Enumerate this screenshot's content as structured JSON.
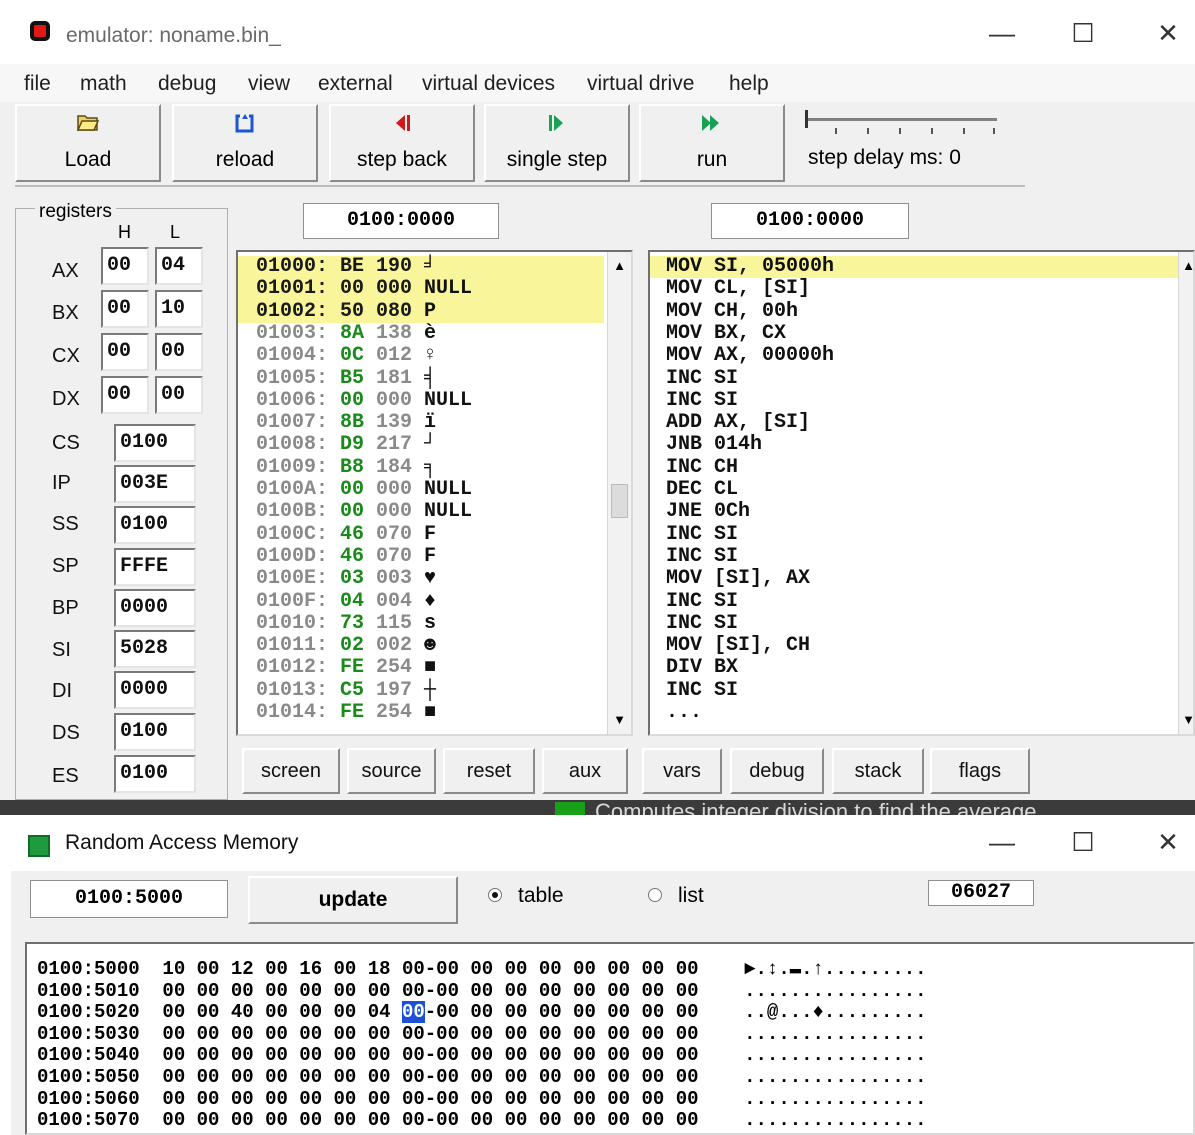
{
  "emulator_window": {
    "title": "emulator: noname.bin_",
    "controls": {
      "minimize": "—",
      "maximize": "☐",
      "close": "✕"
    },
    "menu": [
      "file",
      "math",
      "debug",
      "view",
      "external",
      "virtual devices",
      "virtual drive",
      "help"
    ],
    "toolbar": {
      "load": "Load",
      "reload": "reload",
      "step_back": "step back",
      "single_step": "single step",
      "run": "run",
      "step_delay": "step delay ms: 0"
    },
    "registers": {
      "legend": "registers",
      "col_h": "H",
      "col_l": "L",
      "gp": [
        {
          "name": "AX",
          "h": "00",
          "l": "04"
        },
        {
          "name": "BX",
          "h": "00",
          "l": "10"
        },
        {
          "name": "CX",
          "h": "00",
          "l": "00"
        },
        {
          "name": "DX",
          "h": "00",
          "l": "00"
        }
      ],
      "seg": [
        {
          "name": "CS",
          "value": "0100"
        },
        {
          "name": "IP",
          "value": "003E"
        },
        {
          "name": "SS",
          "value": "0100"
        },
        {
          "name": "SP",
          "value": "FFFE"
        },
        {
          "name": "BP",
          "value": "0000"
        },
        {
          "name": "SI",
          "value": "5028"
        },
        {
          "name": "DI",
          "value": "0000"
        },
        {
          "name": "DS",
          "value": "0100"
        },
        {
          "name": "ES",
          "value": "0100"
        }
      ]
    },
    "memory_address": "0100:0000",
    "disasm_address": "0100:0000",
    "memory_lines": [
      {
        "addr": "01000:",
        "hex": "BE",
        "dec": "190",
        "ch": "╛",
        "hl": true
      },
      {
        "addr": "01001:",
        "hex": "00",
        "dec": "000",
        "ch": "NULL",
        "hl": true
      },
      {
        "addr": "01002:",
        "hex": "50",
        "dec": "080",
        "ch": "P",
        "hl": true
      },
      {
        "addr": "01003:",
        "hex": "8A",
        "dec": "138",
        "ch": "è",
        "hl": false
      },
      {
        "addr": "01004:",
        "hex": "0C",
        "dec": "012",
        "ch": "♀",
        "hl": false
      },
      {
        "addr": "01005:",
        "hex": "B5",
        "dec": "181",
        "ch": "╡",
        "hl": false
      },
      {
        "addr": "01006:",
        "hex": "00",
        "dec": "000",
        "ch": "NULL",
        "hl": false
      },
      {
        "addr": "01007:",
        "hex": "8B",
        "dec": "139",
        "ch": "ï",
        "hl": false
      },
      {
        "addr": "01008:",
        "hex": "D9",
        "dec": "217",
        "ch": "┘",
        "hl": false
      },
      {
        "addr": "01009:",
        "hex": "B8",
        "dec": "184",
        "ch": "╕",
        "hl": false
      },
      {
        "addr": "0100A:",
        "hex": "00",
        "dec": "000",
        "ch": "NULL",
        "hl": false
      },
      {
        "addr": "0100B:",
        "hex": "00",
        "dec": "000",
        "ch": "NULL",
        "hl": false
      },
      {
        "addr": "0100C:",
        "hex": "46",
        "dec": "070",
        "ch": "F",
        "hl": false
      },
      {
        "addr": "0100D:",
        "hex": "46",
        "dec": "070",
        "ch": "F",
        "hl": false
      },
      {
        "addr": "0100E:",
        "hex": "03",
        "dec": "003",
        "ch": "♥",
        "hl": false
      },
      {
        "addr": "0100F:",
        "hex": "04",
        "dec": "004",
        "ch": "♦",
        "hl": false
      },
      {
        "addr": "01010:",
        "hex": "73",
        "dec": "115",
        "ch": "s",
        "hl": false
      },
      {
        "addr": "01011:",
        "hex": "02",
        "dec": "002",
        "ch": "☻",
        "hl": false
      },
      {
        "addr": "01012:",
        "hex": "FE",
        "dec": "254",
        "ch": "■",
        "hl": false
      },
      {
        "addr": "01013:",
        "hex": "C5",
        "dec": "197",
        "ch": "┼",
        "hl": false
      },
      {
        "addr": "01014:",
        "hex": "FE",
        "dec": "254",
        "ch": "■",
        "hl": false
      }
    ],
    "disasm_lines": [
      "MOV SI, 05000h",
      "MOV CL, [SI]",
      "MOV CH, 00h",
      "MOV BX, CX",
      "MOV AX, 00000h",
      "INC SI",
      "INC SI",
      "ADD AX, [SI]",
      "JNB 014h",
      "INC CH",
      "DEC CL",
      "JNE 0Ch",
      "INC SI",
      "INC SI",
      "MOV [SI], AX",
      "INC SI",
      "INC SI",
      "MOV [SI], CH",
      "DIV BX",
      "INC SI",
      "..."
    ],
    "bottom_buttons": [
      "screen",
      "source",
      "reset",
      "aux",
      "vars",
      "debug",
      "stack",
      "flags"
    ]
  },
  "background_window_text": "Computes integer division to find the average",
  "ram_window": {
    "title": "Random Access Memory",
    "controls": {
      "minimize": "—",
      "maximize": "☐",
      "close": "✕"
    },
    "address": "0100:5000",
    "update_label": "update",
    "radio_table": "table",
    "radio_list": "list",
    "value_box": "06027",
    "rows": [
      {
        "addr": "0100:5000",
        "bytes": [
          "10",
          "00",
          "12",
          "00",
          "16",
          "00",
          "18",
          "00",
          "00",
          "00",
          "00",
          "00",
          "00",
          "00",
          "00",
          "00"
        ],
        "ascii": "►.↕.▬.↑........."
      },
      {
        "addr": "0100:5010",
        "bytes": [
          "00",
          "00",
          "00",
          "00",
          "00",
          "00",
          "00",
          "00",
          "00",
          "00",
          "00",
          "00",
          "00",
          "00",
          "00",
          "00"
        ],
        "ascii": "................"
      },
      {
        "addr": "0100:5020",
        "bytes": [
          "00",
          "00",
          "40",
          "00",
          "00",
          "00",
          "04",
          "00",
          "00",
          "00",
          "00",
          "00",
          "00",
          "00",
          "00",
          "00"
        ],
        "ascii": "..@...♦........."
      },
      {
        "addr": "0100:5030",
        "bytes": [
          "00",
          "00",
          "00",
          "00",
          "00",
          "00",
          "00",
          "00",
          "00",
          "00",
          "00",
          "00",
          "00",
          "00",
          "00",
          "00"
        ],
        "ascii": "................"
      },
      {
        "addr": "0100:5040",
        "bytes": [
          "00",
          "00",
          "00",
          "00",
          "00",
          "00",
          "00",
          "00",
          "00",
          "00",
          "00",
          "00",
          "00",
          "00",
          "00",
          "00"
        ],
        "ascii": "................"
      },
      {
        "addr": "0100:5050",
        "bytes": [
          "00",
          "00",
          "00",
          "00",
          "00",
          "00",
          "00",
          "00",
          "00",
          "00",
          "00",
          "00",
          "00",
          "00",
          "00",
          "00"
        ],
        "ascii": "................"
      },
      {
        "addr": "0100:5060",
        "bytes": [
          "00",
          "00",
          "00",
          "00",
          "00",
          "00",
          "00",
          "00",
          "00",
          "00",
          "00",
          "00",
          "00",
          "00",
          "00",
          "00"
        ],
        "ascii": "................"
      },
      {
        "addr": "0100:5070",
        "bytes": [
          "00",
          "00",
          "00",
          "00",
          "00",
          "00",
          "00",
          "00",
          "00",
          "00",
          "00",
          "00",
          "00",
          "00",
          "00",
          "00"
        ],
        "ascii": "................"
      }
    ],
    "selected_row": 2,
    "selected_byte": 7
  },
  "colors": {
    "highlight": "#f8f59a",
    "mem_hex_green": "#1a8a1a",
    "mem_addr_grey": "#8a8a8a",
    "selection_blue": "#1d50d8",
    "step_back_icon": "#d01818",
    "step_icon_green": "#19a055",
    "reload_icon": "#1a56d6"
  }
}
